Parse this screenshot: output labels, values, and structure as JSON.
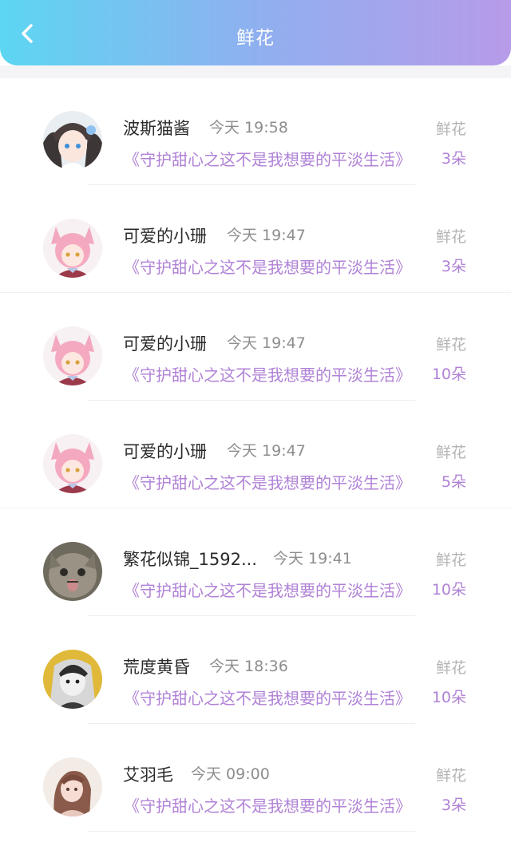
{
  "header": {
    "title": "鲜花",
    "back_icon": "chevron-left-icon"
  },
  "items": [
    {
      "name": "波斯猫酱",
      "time": "今天 19:58",
      "book": "《守护甜心之这不是我想要的平淡生活》",
      "gift_type": "鲜花",
      "count": "3朵"
    },
    {
      "name": "可爱的小珊",
      "time": "今天 19:47",
      "book": "《守护甜心之这不是我想要的平淡生活》",
      "gift_type": "鲜花",
      "count": "3朵"
    },
    {
      "name": "可爱的小珊",
      "time": "今天 19:47",
      "book": "《守护甜心之这不是我想要的平淡生活》",
      "gift_type": "鲜花",
      "count": "10朵"
    },
    {
      "name": "可爱的小珊",
      "time": "今天 19:47",
      "book": "《守护甜心之这不是我想要的平淡生活》",
      "gift_type": "鲜花",
      "count": "5朵"
    },
    {
      "name": "繁花似锦_1592...",
      "time": "今天 19:41",
      "book": "《守护甜心之这不是我想要的平淡生活》",
      "gift_type": "鲜花",
      "count": "10朵"
    },
    {
      "name": "荒度黄昏",
      "time": "今天 18:36",
      "book": "《守护甜心之这不是我想要的平淡生活》",
      "gift_type": "鲜花",
      "count": "10朵"
    },
    {
      "name": "艾羽毛",
      "time": "今天 09:00",
      "book": "《守护甜心之这不是我想要的平淡生活》",
      "gift_type": "鲜花",
      "count": "3朵"
    }
  ],
  "colors": {
    "accent": "#b082d6",
    "header_start": "#5cd6f2",
    "header_end": "#b79be9"
  }
}
